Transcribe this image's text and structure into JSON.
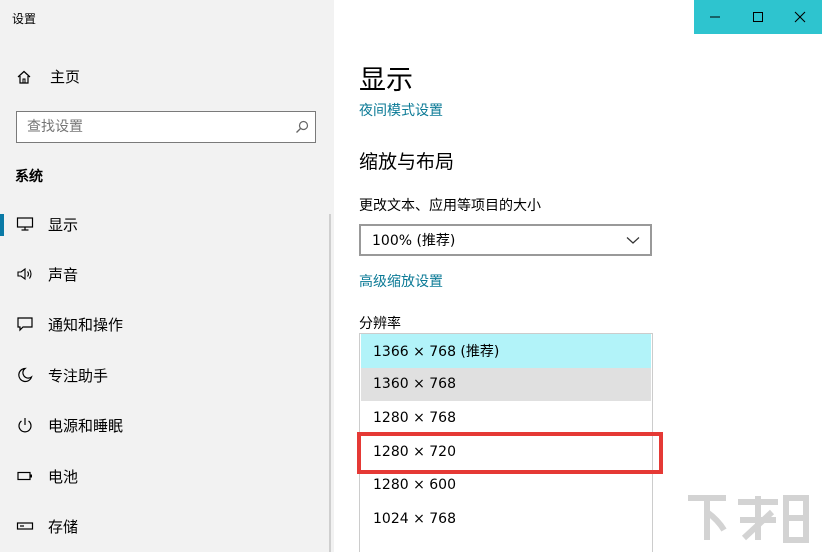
{
  "window": {
    "title": "设置",
    "accent": "#2ec4cf",
    "link_color": "#0b7a96",
    "highlight": "#e53935"
  },
  "sidebar": {
    "home_label": "主页",
    "search_placeholder": "查找设置",
    "section": "系统",
    "items": [
      {
        "label": "显示",
        "icon": "monitor-icon",
        "active": true
      },
      {
        "label": "声音",
        "icon": "speaker-icon"
      },
      {
        "label": "通知和操作",
        "icon": "notification-icon"
      },
      {
        "label": "专注助手",
        "icon": "moon-icon"
      },
      {
        "label": "电源和睡眠",
        "icon": "power-icon"
      },
      {
        "label": "电池",
        "icon": "battery-icon"
      },
      {
        "label": "存储",
        "icon": "storage-icon"
      }
    ]
  },
  "main": {
    "title": "显示",
    "night_mode_link": "夜间模式设置",
    "scale_heading": "缩放与布局",
    "scale_label": "更改文本、应用等项目的大小",
    "scale_value": "100% (推荐)",
    "advanced_scale_link": "高级缩放设置",
    "resolution_label": "分辨率",
    "resolutions": [
      {
        "label": "1366 × 768 (推荐)",
        "state": "selected"
      },
      {
        "label": "1360 × 768",
        "state": "hover"
      },
      {
        "label": "1280 × 768",
        "state": ""
      },
      {
        "label": "1280 × 720",
        "state": "highlighted"
      },
      {
        "label": "1280 × 600",
        "state": ""
      },
      {
        "label": "1024 × 768",
        "state": ""
      }
    ]
  }
}
